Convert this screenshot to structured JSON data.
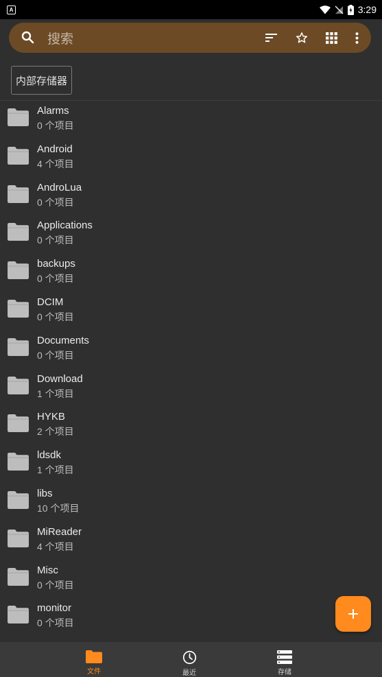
{
  "status": {
    "time": "3:29",
    "left_badge": "A"
  },
  "search": {
    "placeholder": "搜索",
    "icons": [
      "search-icon",
      "sort-icon",
      "star-icon",
      "grid-view-icon",
      "more-vert-icon"
    ]
  },
  "breadcrumb": {
    "label": "内部存储器"
  },
  "colors": {
    "accent": "#ff8a1d",
    "searchbar": "#6b4a25",
    "background": "#2f2f2f",
    "folder": "#bdbdbd"
  },
  "folders": [
    {
      "name": "Alarms",
      "count": "0 个项目"
    },
    {
      "name": "Android",
      "count": "4 个项目"
    },
    {
      "name": "AndroLua",
      "count": "0 个项目"
    },
    {
      "name": "Applications",
      "count": "0 个项目"
    },
    {
      "name": "backups",
      "count": "0 个项目"
    },
    {
      "name": "DCIM",
      "count": "0 个项目"
    },
    {
      "name": "Documents",
      "count": "0 个项目"
    },
    {
      "name": "Download",
      "count": "1 个项目"
    },
    {
      "name": "HYKB",
      "count": "2 个项目"
    },
    {
      "name": "ldsdk",
      "count": "1 个项目"
    },
    {
      "name": "libs",
      "count": "10 个项目"
    },
    {
      "name": "MiReader",
      "count": "4 个项目"
    },
    {
      "name": "Misc",
      "count": "0 个项目"
    },
    {
      "name": "monitor",
      "count": "0 个项目"
    }
  ],
  "fab": {
    "icon": "plus-icon"
  },
  "nav": {
    "items": [
      {
        "label": "文件",
        "icon": "folder-icon",
        "active": true
      },
      {
        "label": "最近",
        "icon": "clock-icon",
        "active": false
      },
      {
        "label": "存储",
        "icon": "storage-icon",
        "active": false
      }
    ]
  }
}
